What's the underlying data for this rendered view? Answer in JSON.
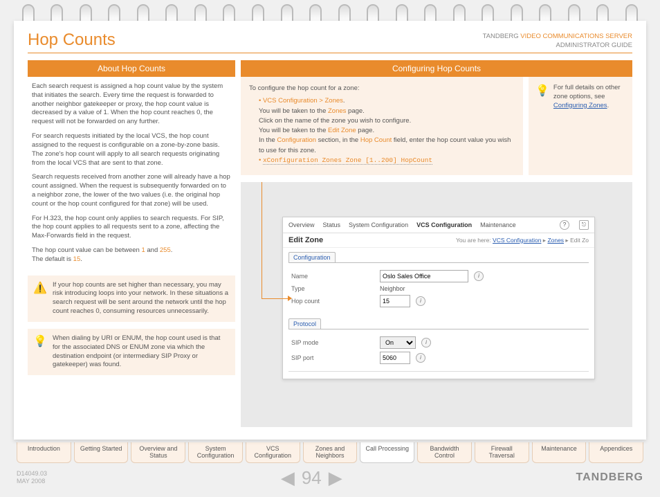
{
  "header": {
    "title": "Hop Counts",
    "brand": "TANDBERG",
    "product": "VIDEO COMMUNICATIONS SERVER",
    "subtitle": "ADMINISTRATOR GUIDE"
  },
  "left": {
    "section_title": "About Hop Counts",
    "p1": "Each search request is assigned a hop count value by the system that initiates the search.  Every time the request is forwarded to another neighbor gatekeeper or proxy, the hop count value is decreased by a value of 1.  When the hop count reaches 0, the request will not be forwarded on any further.",
    "p2": "For search requests initiated by the local VCS, the hop count assigned to the request is configurable on a zone-by-zone basis.  The zone's hop count will apply to all search requests originating from the local VCS that are sent to that zone.",
    "p3": "Search requests received from another zone will already have a hop count assigned.  When the request is subsequently forwarded on to a neighbor zone,  the lower of the two values (i.e. the original hop count or the hop count configured for that zone) will be used.",
    "p4": "For H.323, the hop count only applies to search requests.  For SIP, the hop count applies to all requests sent to a zone, affecting the Max-Forwards field in the request.",
    "p5a": "The hop count value can be between ",
    "p5_min": "1",
    "p5b": " and ",
    "p5_max": "255",
    "p5c": ".",
    "p6a": "The default is ",
    "p6_def": "15",
    "p6b": ".",
    "warn": "If your hop counts are set higher than necessary, you may risk introducing loops into your network.  In these situations a search request will be sent around the network until the hop count reaches 0, consuming resources unnecessarily.",
    "tip": "When dialing by URI or ENUM, the hop count used is that for the associated DNS or ENUM zone via which the destination endpoint (or intermediary SIP Proxy or gatekeeper) was found."
  },
  "right": {
    "section_title": "Configuring Hop Counts",
    "lead": "To configure the hop count for a zone:",
    "step1": "VCS Configuration > Zones",
    "step1_suffix": ".",
    "step2a": "You will be taken to the ",
    "step2_link": "Zones",
    "step2b": " page.",
    "step3": "Click on the name of the zone you wish to configure.",
    "step4a": "You will be taken to the ",
    "step4_link": "Edit Zone",
    "step4b": " page.",
    "step5a": "In the ",
    "step5_conf": "Configuration",
    "step5b": " section, in the ",
    "step5_hop": "Hop Count",
    "step5c": " field, enter the hop count value you wish to use for this zone.",
    "cmd": "xConfiguration Zones Zone [1..200] HopCount",
    "side_tip_a": "For full details on other zone options, see ",
    "side_tip_link": "Configuring Zones",
    "side_tip_b": "."
  },
  "dialog": {
    "tabs": [
      "Overview",
      "Status",
      "System Configuration",
      "VCS Configuration",
      "Maintenance"
    ],
    "active_tab": "VCS Configuration",
    "title": "Edit Zone",
    "crumb_lead": "You are here: ",
    "crumb1": "VCS Configuration",
    "crumb2": "Zones",
    "crumb3": "Edit Zo",
    "inner_tab1": "Configuration",
    "name_lbl": "Name",
    "name_val": "Oslo Sales Office",
    "type_lbl": "Type",
    "type_val": "Neighbor",
    "hop_lbl": "Hop count",
    "hop_val": "15",
    "inner_tab2": "Protocol",
    "sip_mode_lbl": "SIP mode",
    "sip_mode_val": "On",
    "sip_port_lbl": "SIP port",
    "sip_port_val": "5060"
  },
  "nav": {
    "tabs": [
      "Introduction",
      "Getting Started",
      "Overview and Status",
      "System Configuration",
      "VCS Configuration",
      "Zones and Neighbors",
      "Call Processing",
      "Bandwidth Control",
      "Firewall Traversal",
      "Maintenance",
      "Appendices"
    ],
    "active": "Call Processing"
  },
  "footer": {
    "doc_id": "D14049.03",
    "date": "MAY 2008",
    "page": "94",
    "brand": "TANDBERG"
  }
}
